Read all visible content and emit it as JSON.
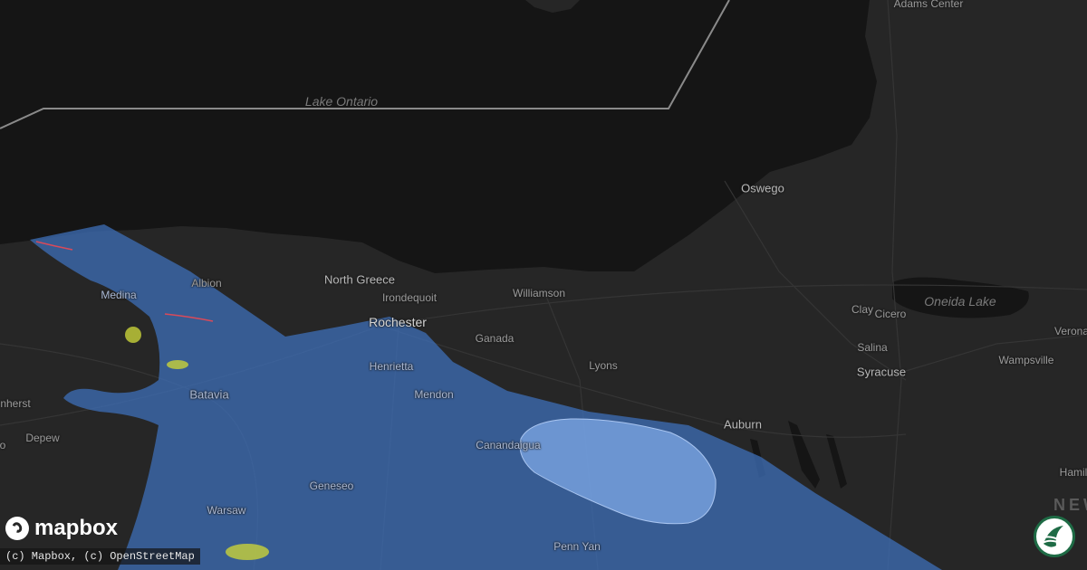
{
  "map": {
    "water_labels": {
      "lake_ontario": "Lake Ontario",
      "oneida_lake": "Oneida Lake"
    },
    "region_label": "NEW",
    "places": {
      "adams_center": "Adams Center",
      "oswego": "Oswego",
      "north_greece": "North Greece",
      "irondequoit": "Irondequoit",
      "williamson": "Williamson",
      "albion": "Albion",
      "medina": "Medina",
      "rochester": "Rochester",
      "ganada": "Ganada",
      "henrietta": "Henrietta",
      "lyons": "Lyons",
      "mendon": "Mendon",
      "batavia": "Batavia",
      "canandaigua": "Canandaigua",
      "auburn": "Auburn",
      "clay": "Clay",
      "cicero": "Cicero",
      "salina": "Salina",
      "syracuse": "Syracuse",
      "verona": "Verona",
      "wampsville": "Wampsville",
      "amherst": "nherst",
      "depew": "Depew",
      "geneseo": "Geneseo",
      "warsaw": "Warsaw",
      "penn_yan": "Penn Yan",
      "hamilton": "Hamil",
      "edge_o": "o"
    },
    "colors": {
      "land": "#262626",
      "water": "#151515",
      "swath": "#3d6fb8",
      "core": "#7fa8e6",
      "warning_line": "#d94a5a",
      "spot": "#c8d23a"
    }
  },
  "branding": {
    "logo_text": "mapbox",
    "attribution": "(c) Mapbox, (c) OpenStreetMap"
  }
}
